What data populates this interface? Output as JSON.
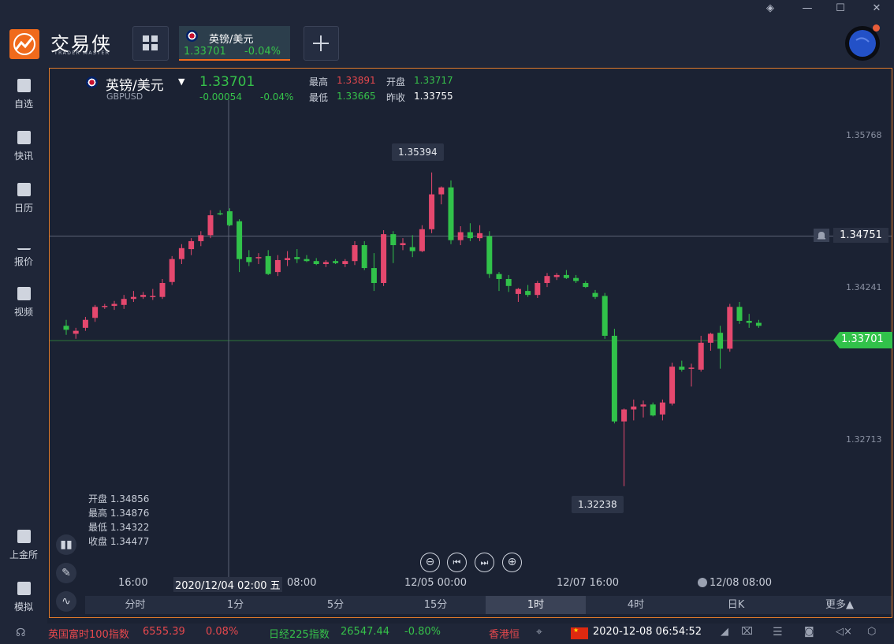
{
  "window": {
    "controls": [
      "◈",
      "—",
      "☐",
      "✕"
    ]
  },
  "brand": {
    "name": "交易侠",
    "sub": "TRADER MASTER"
  },
  "active_tab": {
    "name": "英镑/美元",
    "price": "1.33701",
    "change": "-0.04%"
  },
  "sidebar": {
    "items": [
      {
        "label": "自选",
        "icon": "star-bookmark-icon"
      },
      {
        "label": "快讯",
        "icon": "news-icon"
      },
      {
        "label": "日历",
        "icon": "calendar-icon"
      },
      {
        "label": "报价",
        "icon": "quote-icon"
      },
      {
        "label": "视频",
        "icon": "video-icon"
      },
      {
        "label": "上金所",
        "icon": "exchange-icon"
      },
      {
        "label": "模拟",
        "icon": "wallet-icon"
      }
    ]
  },
  "symbol": {
    "name": "英镑/美元",
    "code": "GBPUSD",
    "price": "1.33701",
    "change": "-0.00054",
    "change_pct": "-0.04%",
    "high_label": "最高",
    "high": "1.33891",
    "open_label": "开盘",
    "open": "1.33717",
    "low_label": "最低",
    "low": "1.33665",
    "prev_label": "昨收",
    "prev": "1.33755"
  },
  "axis_prices": [
    "1.35768",
    "1.34241",
    "1.32713"
  ],
  "crosshair_price": "1.34751",
  "current_price_tag": "1.33701",
  "max_tooltip": "1.35394",
  "min_tooltip": "1.32238",
  "ohlc": {
    "open": "开盘 1.34856",
    "high": "最高 1.34876",
    "low": "最低 1.34322",
    "close": "收盘 1.34477"
  },
  "time_labels": [
    "16:00",
    "2020/12/04 02:00 五",
    "08:00",
    "12/05 00:00",
    "12/07 16:00",
    "12/08 08:00"
  ],
  "periods": [
    "分时",
    "1分",
    "5分",
    "15分",
    "1时",
    "4时",
    "日K",
    "更多▲"
  ],
  "active_period": "1时",
  "nav_buttons": [
    "⊖",
    "⏮",
    "⏭",
    "⊕"
  ],
  "ticker": [
    {
      "name": "英国富时100指数",
      "value": "6555.39",
      "change": "0.08%",
      "color": "#e5484d"
    },
    {
      "name": "日经225指数",
      "value": "26547.44",
      "change": "-0.80%",
      "color": "#36c24a"
    },
    {
      "name": "香港恒",
      "value": "",
      "change": "",
      "color": "#e5484d"
    }
  ],
  "datetime": "2020-12-08 06:54:52",
  "colors": {
    "up": "#e5486e",
    "down": "#31c24a",
    "accent": "#f06a1c",
    "bg": "#1b2233"
  },
  "chart_data": {
    "type": "candlestick",
    "symbol": "GBPUSD",
    "ylim": [
      1.32,
      1.36
    ],
    "yticks": [
      1.35768,
      1.34241,
      1.32713
    ],
    "x_labels": [
      "16:00",
      "2020/12/04 02:00 五",
      "08:00",
      "12/05 00:00",
      "12/07 16:00",
      "12/08 08:00"
    ],
    "candles": [
      {
        "o": 1.3385,
        "h": 1.3391,
        "l": 1.3376,
        "c": 1.3381
      },
      {
        "o": 1.3377,
        "h": 1.3383,
        "l": 1.3372,
        "c": 1.338
      },
      {
        "o": 1.3383,
        "h": 1.3394,
        "l": 1.338,
        "c": 1.3391
      },
      {
        "o": 1.3393,
        "h": 1.3406,
        "l": 1.3389,
        "c": 1.3404
      },
      {
        "o": 1.3404,
        "h": 1.3407,
        "l": 1.3402,
        "c": 1.3405
      },
      {
        "o": 1.3405,
        "h": 1.341,
        "l": 1.3401,
        "c": 1.3407
      },
      {
        "o": 1.3406,
        "h": 1.3416,
        "l": 1.3402,
        "c": 1.3412
      },
      {
        "o": 1.3412,
        "h": 1.342,
        "l": 1.3409,
        "c": 1.3414
      },
      {
        "o": 1.3414,
        "h": 1.3419,
        "l": 1.3412,
        "c": 1.3416
      },
      {
        "o": 1.3415,
        "h": 1.3422,
        "l": 1.3411,
        "c": 1.3415
      },
      {
        "o": 1.3414,
        "h": 1.3432,
        "l": 1.3412,
        "c": 1.3428
      },
      {
        "o": 1.3429,
        "h": 1.3455,
        "l": 1.3426,
        "c": 1.3452
      },
      {
        "o": 1.3452,
        "h": 1.3467,
        "l": 1.3447,
        "c": 1.3463
      },
      {
        "o": 1.3462,
        "h": 1.3473,
        "l": 1.3456,
        "c": 1.347
      },
      {
        "o": 1.347,
        "h": 1.348,
        "l": 1.3465,
        "c": 1.3476
      },
      {
        "o": 1.3476,
        "h": 1.3501,
        "l": 1.3473,
        "c": 1.3496
      },
      {
        "o": 1.3498,
        "h": 1.3501,
        "l": 1.3496,
        "c": 1.3497
      },
      {
        "o": 1.35,
        "h": 1.3503,
        "l": 1.3485,
        "c": 1.3486
      },
      {
        "o": 1.349,
        "h": 1.3492,
        "l": 1.3439,
        "c": 1.3452
      },
      {
        "o": 1.3454,
        "h": 1.3461,
        "l": 1.3445,
        "c": 1.3449
      },
      {
        "o": 1.3453,
        "h": 1.3458,
        "l": 1.3447,
        "c": 1.3454
      },
      {
        "o": 1.3455,
        "h": 1.3461,
        "l": 1.3436,
        "c": 1.3437
      },
      {
        "o": 1.3439,
        "h": 1.3456,
        "l": 1.3435,
        "c": 1.3451
      },
      {
        "o": 1.3451,
        "h": 1.346,
        "l": 1.3445,
        "c": 1.3453
      },
      {
        "o": 1.3454,
        "h": 1.3462,
        "l": 1.3448,
        "c": 1.3452
      },
      {
        "o": 1.3452,
        "h": 1.3456,
        "l": 1.3449,
        "c": 1.345
      },
      {
        "o": 1.345,
        "h": 1.3453,
        "l": 1.3446,
        "c": 1.3447
      },
      {
        "o": 1.3447,
        "h": 1.3451,
        "l": 1.3444,
        "c": 1.3449
      },
      {
        "o": 1.345,
        "h": 1.3452,
        "l": 1.3447,
        "c": 1.3448
      },
      {
        "o": 1.3447,
        "h": 1.3452,
        "l": 1.3444,
        "c": 1.345
      },
      {
        "o": 1.345,
        "h": 1.347,
        "l": 1.3446,
        "c": 1.3466
      },
      {
        "o": 1.3466,
        "h": 1.347,
        "l": 1.3441,
        "c": 1.3443
      },
      {
        "o": 1.3443,
        "h": 1.3458,
        "l": 1.342,
        "c": 1.3428
      },
      {
        "o": 1.3428,
        "h": 1.3481,
        "l": 1.3425,
        "c": 1.3477
      },
      {
        "o": 1.3477,
        "h": 1.348,
        "l": 1.3448,
        "c": 1.3466
      },
      {
        "o": 1.3466,
        "h": 1.3473,
        "l": 1.3461,
        "c": 1.3468
      },
      {
        "o": 1.3464,
        "h": 1.3476,
        "l": 1.3454,
        "c": 1.346
      },
      {
        "o": 1.346,
        "h": 1.3486,
        "l": 1.3459,
        "c": 1.3482
      },
      {
        "o": 1.3482,
        "h": 1.3539,
        "l": 1.3478,
        "c": 1.3517
      },
      {
        "o": 1.3517,
        "h": 1.3525,
        "l": 1.3507,
        "c": 1.3524
      },
      {
        "o": 1.3524,
        "h": 1.3531,
        "l": 1.3467,
        "c": 1.3471
      },
      {
        "o": 1.3471,
        "h": 1.3485,
        "l": 1.3466,
        "c": 1.3479
      },
      {
        "o": 1.3479,
        "h": 1.3488,
        "l": 1.347,
        "c": 1.3473
      },
      {
        "o": 1.3473,
        "h": 1.3486,
        "l": 1.347,
        "c": 1.3478
      },
      {
        "o": 1.3475,
        "h": 1.348,
        "l": 1.3433,
        "c": 1.3437
      },
      {
        "o": 1.3437,
        "h": 1.3439,
        "l": 1.342,
        "c": 1.3432
      },
      {
        "o": 1.3432,
        "h": 1.3436,
        "l": 1.3419,
        "c": 1.3425
      },
      {
        "o": 1.3417,
        "h": 1.3423,
        "l": 1.3409,
        "c": 1.3422
      },
      {
        "o": 1.342,
        "h": 1.3426,
        "l": 1.3414,
        "c": 1.3416
      },
      {
        "o": 1.3416,
        "h": 1.343,
        "l": 1.3413,
        "c": 1.3428
      },
      {
        "o": 1.3428,
        "h": 1.3438,
        "l": 1.3424,
        "c": 1.3435
      },
      {
        "o": 1.3434,
        "h": 1.3438,
        "l": 1.3431,
        "c": 1.3436
      },
      {
        "o": 1.3436,
        "h": 1.3441,
        "l": 1.3432,
        "c": 1.3433
      },
      {
        "o": 1.3433,
        "h": 1.3436,
        "l": 1.3428,
        "c": 1.343
      },
      {
        "o": 1.3428,
        "h": 1.343,
        "l": 1.3423,
        "c": 1.3424
      },
      {
        "o": 1.3418,
        "h": 1.3421,
        "l": 1.3412,
        "c": 1.3414
      },
      {
        "o": 1.3415,
        "h": 1.3418,
        "l": 1.3372,
        "c": 1.3375
      },
      {
        "o": 1.3375,
        "h": 1.3382,
        "l": 1.3287,
        "c": 1.3289
      },
      {
        "o": 1.3289,
        "h": 1.3302,
        "l": 1.3224,
        "c": 1.3301
      },
      {
        "o": 1.3301,
        "h": 1.3311,
        "l": 1.329,
        "c": 1.3304
      },
      {
        "o": 1.3304,
        "h": 1.331,
        "l": 1.3293,
        "c": 1.3306
      },
      {
        "o": 1.3306,
        "h": 1.3308,
        "l": 1.3294,
        "c": 1.3295
      },
      {
        "o": 1.3296,
        "h": 1.3311,
        "l": 1.329,
        "c": 1.3308
      },
      {
        "o": 1.3307,
        "h": 1.3348,
        "l": 1.3305,
        "c": 1.3344
      },
      {
        "o": 1.3344,
        "h": 1.335,
        "l": 1.3339,
        "c": 1.3341
      },
      {
        "o": 1.3343,
        "h": 1.3347,
        "l": 1.3324,
        "c": 1.3343
      },
      {
        "o": 1.3341,
        "h": 1.3375,
        "l": 1.3339,
        "c": 1.3368
      },
      {
        "o": 1.3368,
        "h": 1.3378,
        "l": 1.336,
        "c": 1.3377
      },
      {
        "o": 1.3378,
        "h": 1.3385,
        "l": 1.3342,
        "c": 1.3362
      },
      {
        "o": 1.3362,
        "h": 1.3407,
        "l": 1.3359,
        "c": 1.3404
      },
      {
        "o": 1.3404,
        "h": 1.3409,
        "l": 1.3387,
        "c": 1.339
      },
      {
        "o": 1.339,
        "h": 1.3397,
        "l": 1.3383,
        "c": 1.3388
      },
      {
        "o": 1.3388,
        "h": 1.3391,
        "l": 1.3383,
        "c": 1.3385
      }
    ],
    "annotations": {
      "max": "1.35394",
      "min": "1.32238",
      "last": "1.33701"
    }
  }
}
